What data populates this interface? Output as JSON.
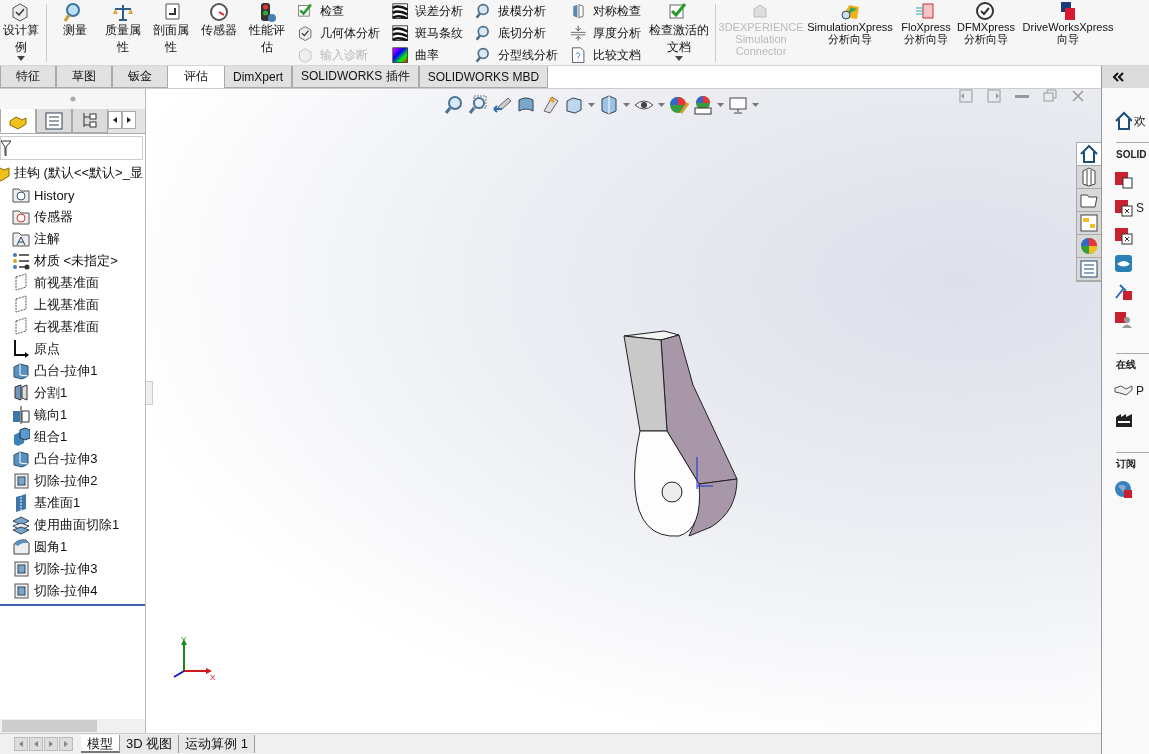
{
  "ribbon": {
    "design_study": {
      "label": "设计算例"
    },
    "large_buttons": [
      {
        "label": "测量"
      },
      {
        "label": "质量属性"
      },
      {
        "label": "剖面属性"
      },
      {
        "label": "传感器"
      },
      {
        "label": "性能评估"
      }
    ],
    "small_columns": [
      [
        {
          "label": "检查",
          "disabled": false
        },
        {
          "label": "几何体分析",
          "disabled": false
        },
        {
          "label": "输入诊断",
          "disabled": true
        }
      ],
      [
        {
          "label": "误差分析",
          "disabled": false
        },
        {
          "label": "斑马条纹",
          "disabled": false
        },
        {
          "label": "曲率",
          "disabled": false
        }
      ],
      [
        {
          "label": "拔模分析",
          "disabled": false
        },
        {
          "label": "底切分析",
          "disabled": false
        },
        {
          "label": "分型线分析",
          "disabled": false
        }
      ],
      [
        {
          "label": "对称检查",
          "disabled": false
        },
        {
          "label": "厚度分析",
          "disabled": false
        },
        {
          "label": "比较文档",
          "disabled": false
        }
      ]
    ],
    "check_document": {
      "label": "检查激活的文档"
    },
    "xpress_buttons": [
      {
        "label": "3DEXPERIENCE Simulation Connector",
        "disabled": true
      },
      {
        "label": "SimulationXpress 分析向导",
        "disabled": false
      },
      {
        "label": "FloXpress 分析向导",
        "disabled": false
      },
      {
        "label": "DFMXpress 分析向导",
        "disabled": false
      },
      {
        "label": "DriveWorksXpress 向导",
        "disabled": false
      }
    ]
  },
  "command_tabs": [
    {
      "label": "特征",
      "selected": false
    },
    {
      "label": "草图",
      "selected": false
    },
    {
      "label": "钣金",
      "selected": false
    },
    {
      "label": "评估",
      "selected": true
    },
    {
      "label": "DimXpert",
      "selected": false
    },
    {
      "label": "SOLIDWORKS 插件",
      "selected": false
    },
    {
      "label": "SOLIDWORKS MBD",
      "selected": false
    }
  ],
  "feature_tree": {
    "panel_tabs": [
      {
        "selected": true
      },
      {
        "selected": false
      },
      {
        "selected": false
      }
    ],
    "root": {
      "label": "挂钩  (默认<<默认>_显",
      "children": [
        {
          "label": "History",
          "kind": "history"
        },
        {
          "label": "传感器",
          "kind": "sensor"
        },
        {
          "label": "注解",
          "kind": "annotation"
        },
        {
          "label": "材质 <未指定>",
          "kind": "material"
        },
        {
          "label": "前视基准面",
          "kind": "plane"
        },
        {
          "label": "上视基准面",
          "kind": "plane"
        },
        {
          "label": "右视基准面",
          "kind": "plane"
        },
        {
          "label": "原点",
          "kind": "origin"
        },
        {
          "label": "凸台-拉伸1",
          "kind": "boss"
        },
        {
          "label": "分割1",
          "kind": "split"
        },
        {
          "label": "镜向1",
          "kind": "mirror"
        },
        {
          "label": "组合1",
          "kind": "combine"
        },
        {
          "label": "凸台-拉伸3",
          "kind": "boss"
        },
        {
          "label": "切除-拉伸2",
          "kind": "cut"
        },
        {
          "label": "基准面1",
          "kind": "refplane"
        },
        {
          "label": "使用曲面切除1",
          "kind": "surfcut"
        },
        {
          "label": "圆角1",
          "kind": "fillet"
        },
        {
          "label": "切除-拉伸3",
          "kind": "cut"
        },
        {
          "label": "切除-拉伸4",
          "kind": "cut"
        }
      ]
    }
  },
  "viewport": {
    "triad": {
      "y_label": "Y",
      "x_label": "X"
    },
    "side_tabs": [
      {
        "selected": true
      },
      {
        "selected": false
      },
      {
        "selected": false
      },
      {
        "selected": false
      },
      {
        "selected": false
      },
      {
        "selected": false
      }
    ]
  },
  "task_pane": {
    "welcome": "欢",
    "section_1": "SOLID",
    "items_1": [
      {
        "kind": "doc"
      },
      {
        "label": "S",
        "kind": "fx"
      },
      {
        "kind": "fx"
      },
      {
        "kind": "eye"
      },
      {
        "kind": "tools"
      },
      {
        "kind": "person"
      }
    ],
    "section_2": "在线",
    "items_2": [
      {
        "label": "P",
        "kind": "hands"
      },
      {
        "kind": "factory"
      }
    ],
    "section_3": "订阅",
    "items_3": [
      {
        "kind": "globe"
      }
    ]
  },
  "bottom_tabs": [
    {
      "label": "模型",
      "selected": true
    },
    {
      "label": "3D 视图",
      "selected": false
    },
    {
      "label": "运动算例 1",
      "selected": false
    }
  ]
}
